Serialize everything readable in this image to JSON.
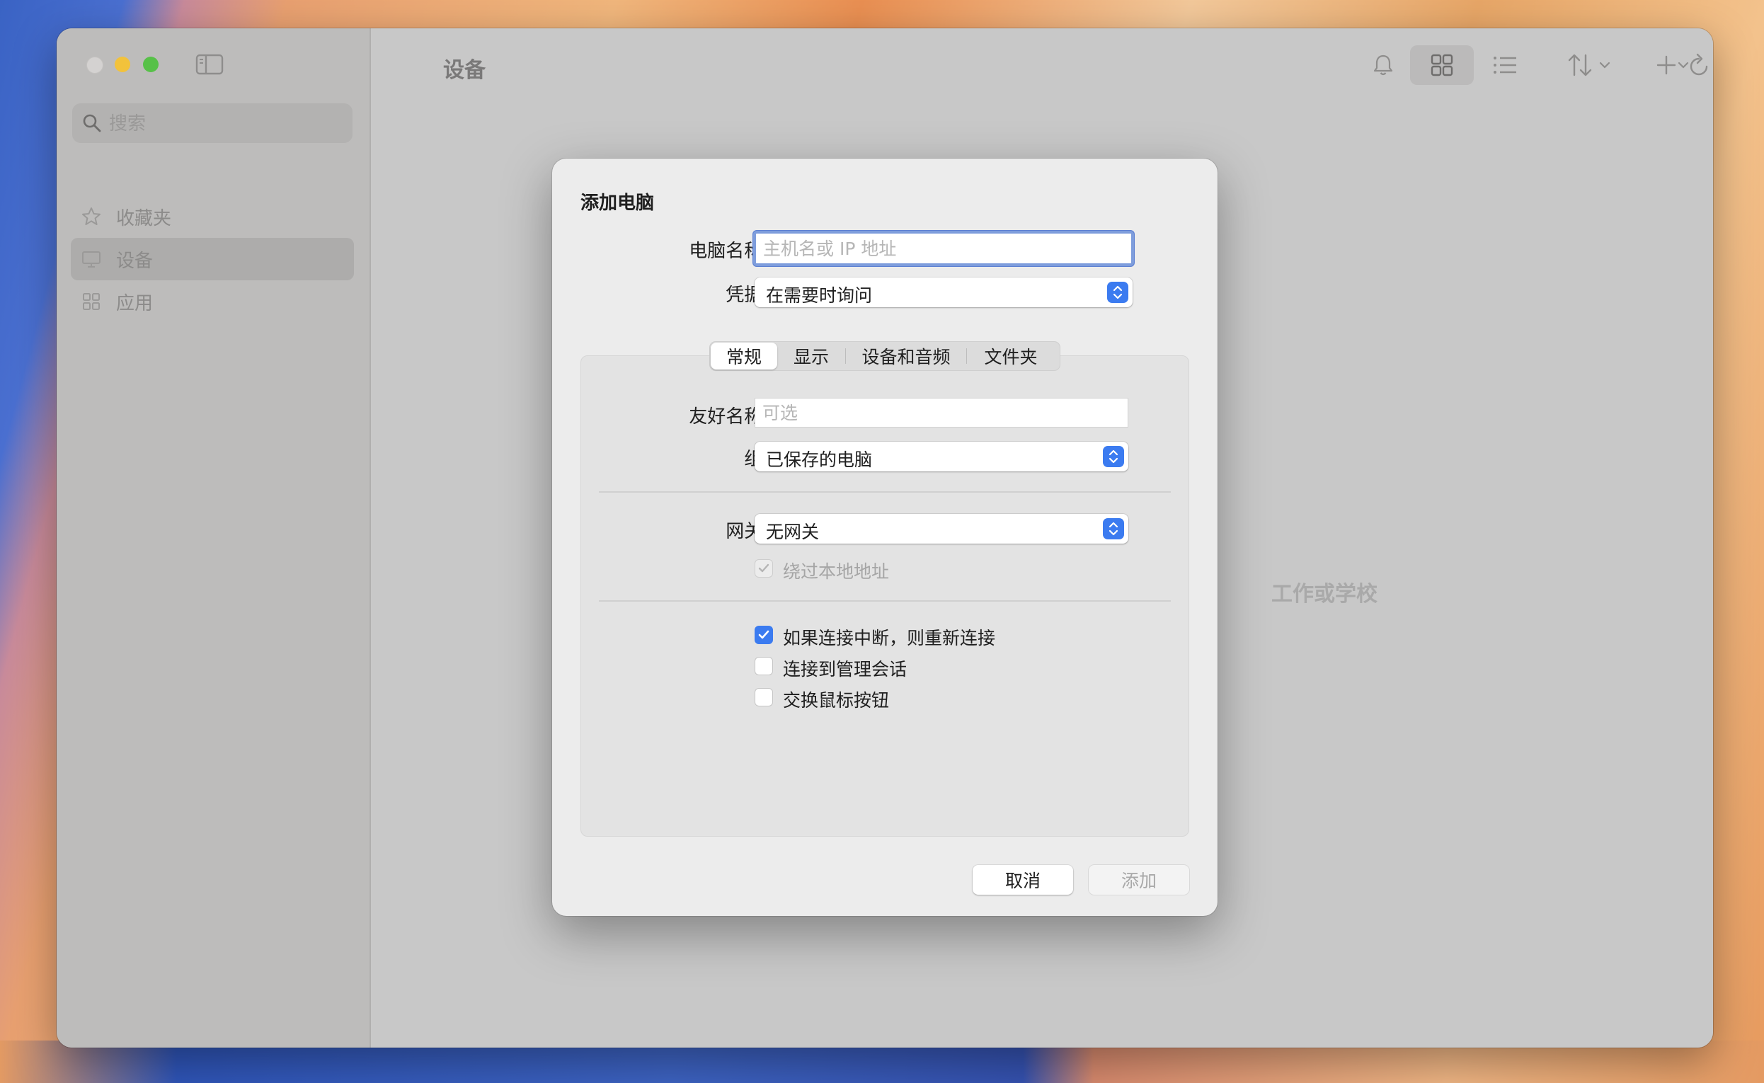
{
  "sidebar": {
    "search_placeholder": "搜索",
    "items": [
      {
        "label": "收藏夹",
        "icon": "star-icon"
      },
      {
        "label": "设备",
        "icon": "monitor-icon"
      },
      {
        "label": "应用",
        "icon": "apps-grid-icon"
      }
    ]
  },
  "main": {
    "title": "设备",
    "empty_hint": "工作或学校"
  },
  "dialog": {
    "title": "添加电脑",
    "pc_name_label": "电脑名称:",
    "pc_name_placeholder": "主机名或 IP 地址",
    "credentials_label": "凭据:",
    "credentials_value": "在需要时询问",
    "tabs": [
      "常规",
      "显示",
      "设备和音频",
      "文件夹"
    ],
    "friendly_name_label": "友好名称:",
    "friendly_name_placeholder": "可选",
    "group_label": "组:",
    "group_value": "已保存的电脑",
    "gateway_label": "网关:",
    "gateway_value": "无网关",
    "bypass_local_label": "绕过本地地址",
    "reconnect_label": "如果连接中断，则重新连接",
    "admin_session_label": "连接到管理会话",
    "swap_mouse_label": "交换鼠标按钮",
    "cancel_label": "取消",
    "add_label": "添加"
  },
  "colors": {
    "accent": "#3b7bf0",
    "focus_ring": "#7e9ddc"
  }
}
